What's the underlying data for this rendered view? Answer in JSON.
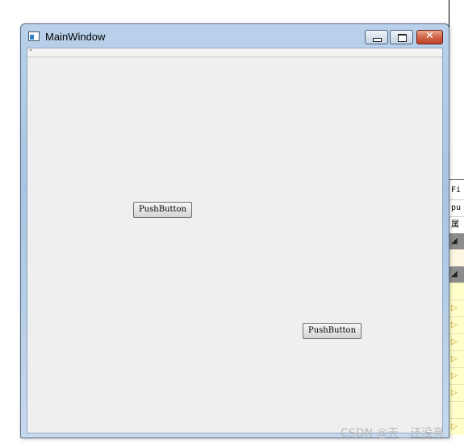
{
  "window": {
    "title": "MainWindow",
    "close_glyph": "✕"
  },
  "buttons": [
    {
      "label": "PushButton"
    },
    {
      "label": "PushButton"
    }
  ],
  "editor_panel": {
    "rows": [
      "Fi",
      "pu",
      "属",
      "◢",
      "",
      "◢",
      "",
      "▷",
      "▷",
      "▷",
      "▷",
      "▷",
      "▷",
      "",
      "▷"
    ]
  },
  "watermark": "CSDN @天＿还没亮"
}
